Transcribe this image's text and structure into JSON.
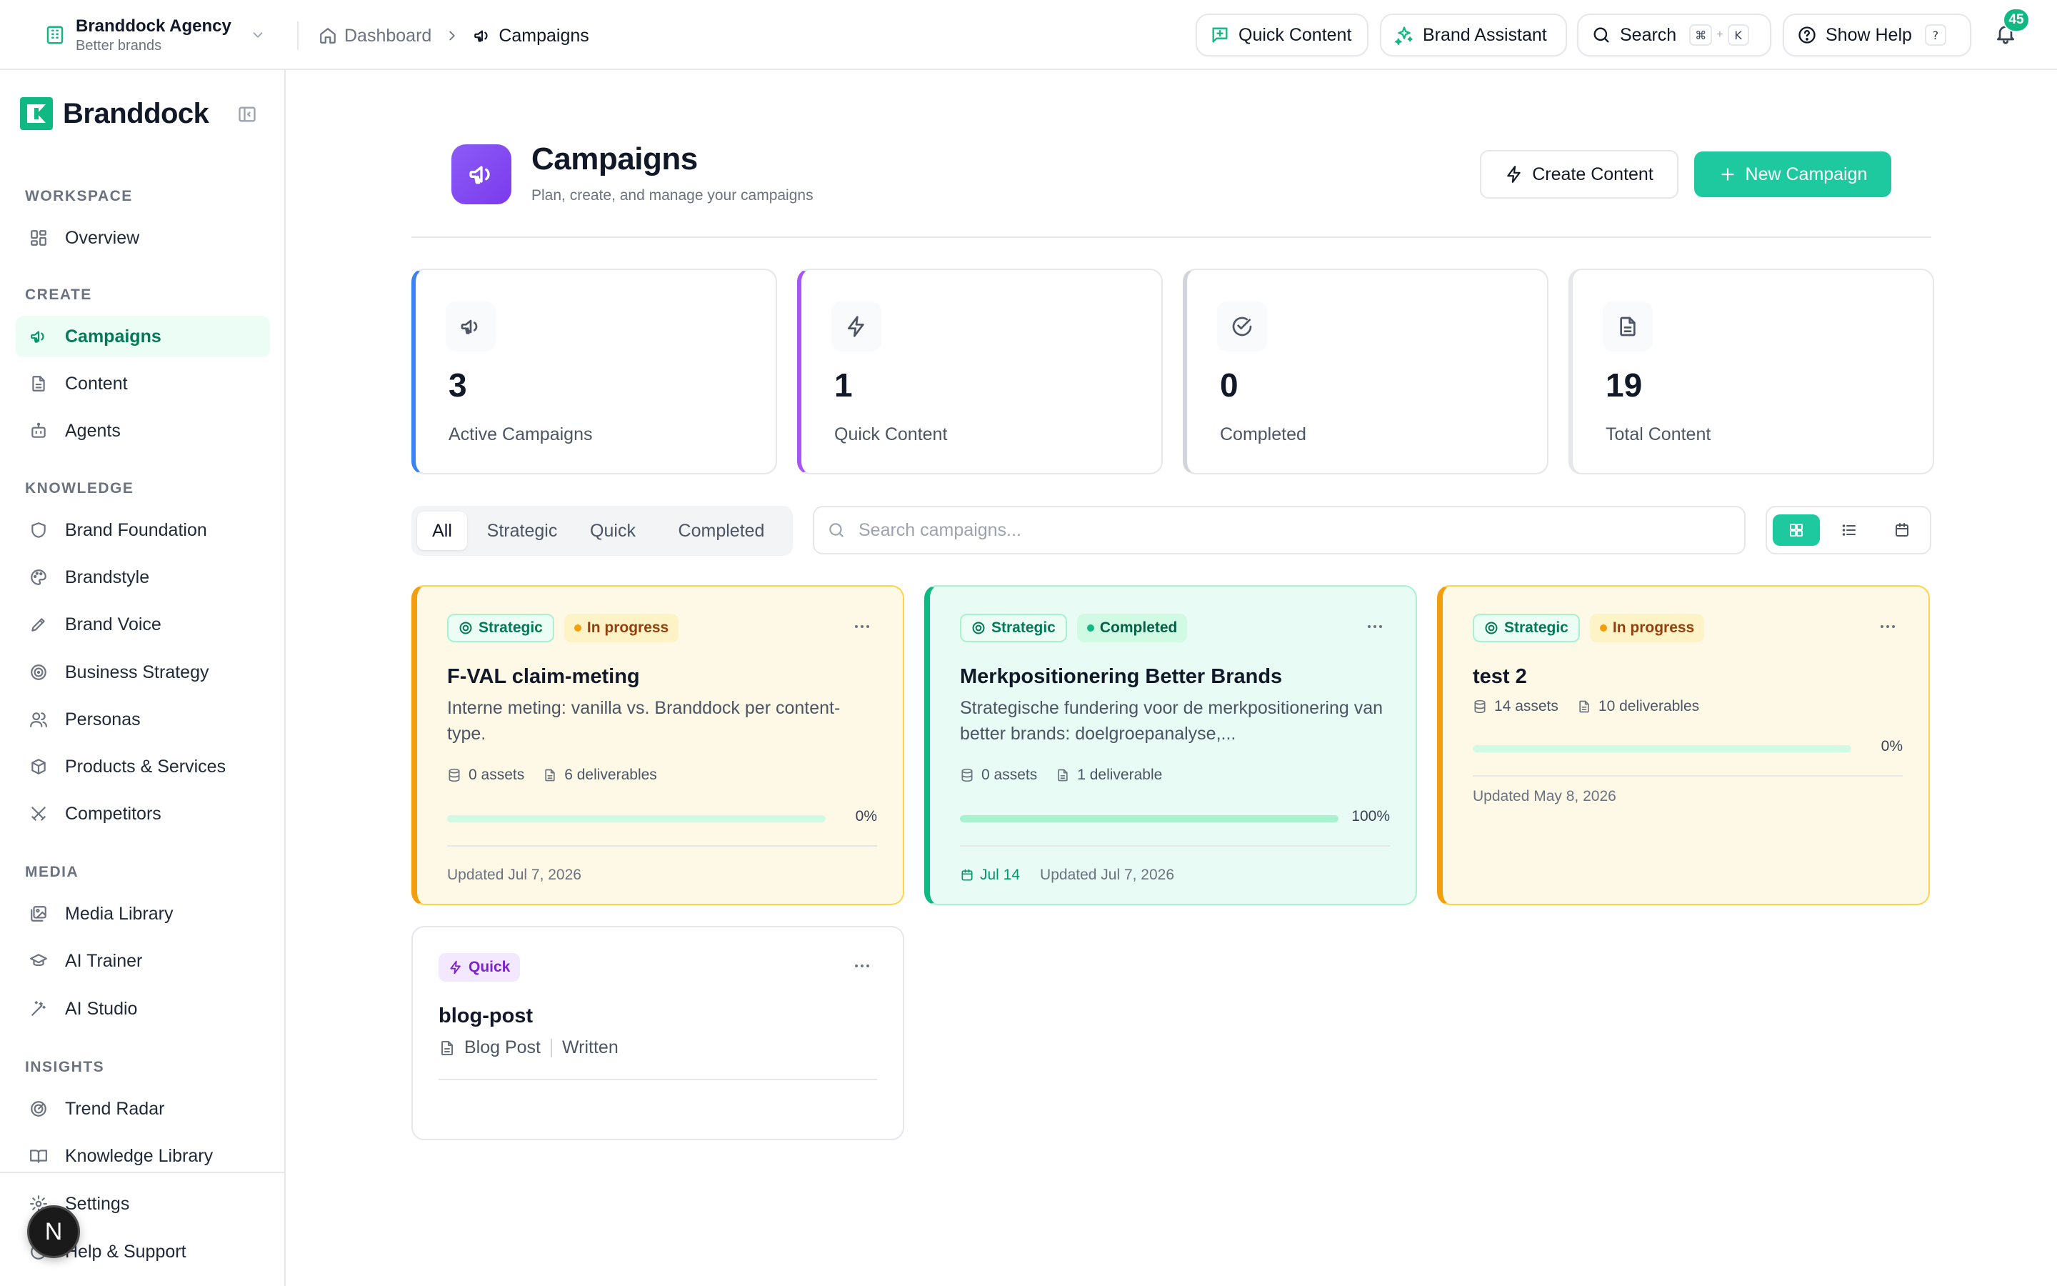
{
  "workspace": {
    "name": "Branddock Agency",
    "subtitle": "Better brands"
  },
  "breadcrumb": {
    "home": "Dashboard",
    "current": "Campaigns"
  },
  "topbar": {
    "quick_content": "Quick Content",
    "brand_assistant": "Brand Assistant",
    "search": "Search",
    "search_key1": "⌘",
    "search_plus": "+",
    "search_key2": "K",
    "show_help": "Show Help",
    "help_key": "?",
    "notifications_count": "45"
  },
  "sidebar": {
    "brand": "Branddock",
    "sections": {
      "workspace": "WORKSPACE",
      "create": "CREATE",
      "knowledge": "KNOWLEDGE",
      "media": "MEDIA",
      "insights": "INSIGHTS"
    },
    "items": {
      "overview": "Overview",
      "campaigns": "Campaigns",
      "content": "Content",
      "agents": "Agents",
      "brand_foundation": "Brand Foundation",
      "brandstyle": "Brandstyle",
      "brand_voice": "Brand Voice",
      "business_strategy": "Business Strategy",
      "personas": "Personas",
      "products_services": "Products & Services",
      "competitors": "Competitors",
      "media_library": "Media Library",
      "ai_trainer": "AI Trainer",
      "ai_studio": "AI Studio",
      "trend_radar": "Trend Radar",
      "knowledge_library": "Knowledge Library",
      "settings": "Settings",
      "help_support": "Help & Support"
    },
    "active": "campaigns",
    "fab_letter": "N"
  },
  "page": {
    "title": "Campaigns",
    "subtitle": "Plan, create, and manage your campaigns",
    "create_content": "Create Content",
    "new_campaign": "New Campaign"
  },
  "stats": [
    {
      "value": "3",
      "label": "Active Campaigns",
      "accent": "#3b82f6",
      "icon": "megaphone-icon"
    },
    {
      "value": "1",
      "label": "Quick Content",
      "accent": "#a855f7",
      "icon": "lightning-icon"
    },
    {
      "value": "0",
      "label": "Completed",
      "accent": "#d1d5db",
      "icon": "check-circle-icon"
    },
    {
      "value": "19",
      "label": "Total Content",
      "accent": "#e5e7eb",
      "icon": "document-icon"
    }
  ],
  "filters": {
    "tabs": [
      "All",
      "Strategic",
      "Quick",
      "Completed"
    ],
    "active": "All",
    "search_placeholder": "Search campaigns...",
    "view": "grid"
  },
  "campaigns": [
    {
      "type": "Strategic",
      "status": "In progress",
      "title": "F-VAL claim-meting",
      "description": "Interne meting: vanilla vs. Branddock per content-type.",
      "assets": "0 assets",
      "deliverables": "6 deliverables",
      "progress": 0,
      "progress_label": "0%",
      "updated": "Updated Jul 7, 2026"
    },
    {
      "type": "Strategic",
      "status": "Completed",
      "title": "Merkpositionering Better Brands",
      "description": "Strategische fundering voor de merkpositionering van better brands: doelgroepanalyse,...",
      "assets": "0 assets",
      "deliverables": "1 deliverable",
      "progress": 100,
      "progress_label": "100%",
      "due": "Jul 14",
      "updated": "Updated Jul 7, 2026"
    },
    {
      "type": "Strategic",
      "status": "In progress",
      "title": "test 2",
      "assets": "14 assets",
      "deliverables": "10 deliverables",
      "progress": 0,
      "progress_label": "0%",
      "updated": "Updated May 8, 2026"
    },
    {
      "type": "Quick",
      "title": "blog-post",
      "content_type": "Blog Post",
      "content_mode": "Written"
    }
  ],
  "colors": {
    "accent": "#1fc99f",
    "brand_green": "#10b981",
    "in_progress": "#f59e0b",
    "completed": "#10b981",
    "quick": "#a855f7"
  }
}
